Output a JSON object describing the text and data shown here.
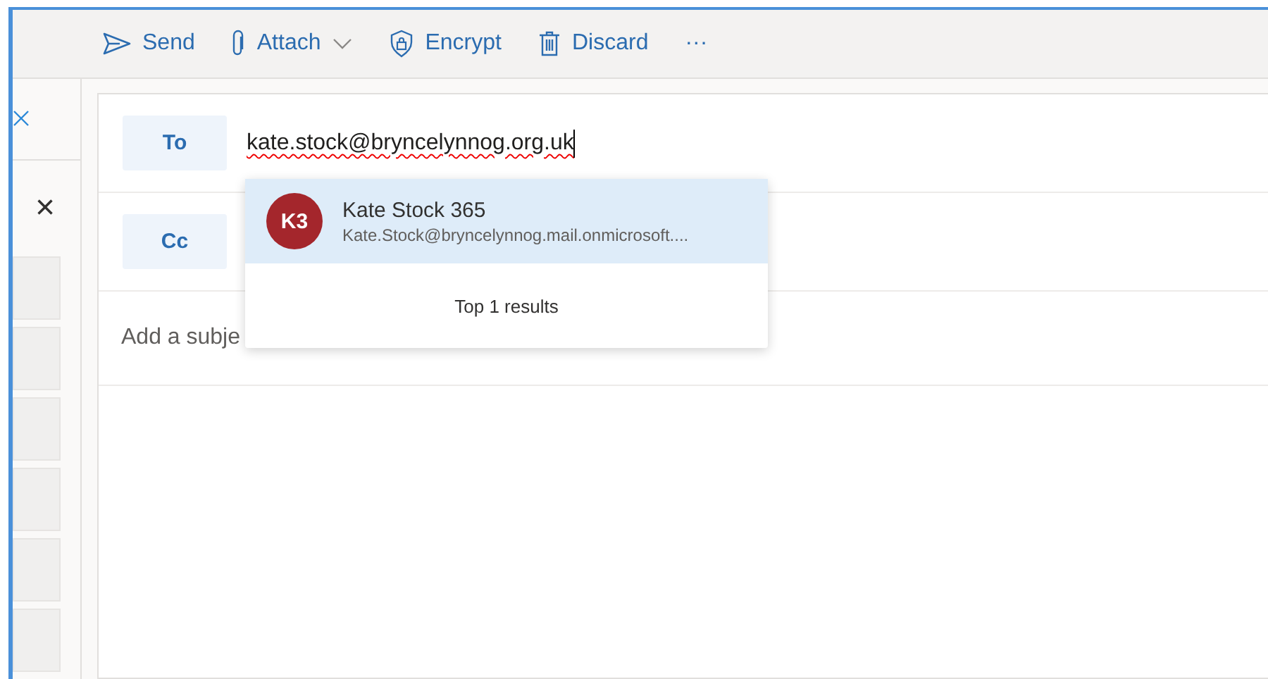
{
  "toolbar": [
    {
      "kind": "send",
      "label": "Send"
    },
    {
      "kind": "attach",
      "label": "Attach"
    },
    {
      "kind": "encrypt",
      "label": "Encrypt"
    },
    {
      "kind": "discard",
      "label": "Discard"
    },
    {
      "kind": "more",
      "label": "···"
    }
  ],
  "side_close": "×",
  "to": {
    "label": "To",
    "value": "kate.stock@bryncelynnog.org.uk"
  },
  "cc": {
    "label": "Cc"
  },
  "subject": {
    "placeholder": "Add a subje"
  },
  "suggestions": {
    "items": [
      {
        "initials": "K3",
        "name": "Kate Stock 365",
        "email": "Kate.Stock@bryncelynnog.mail.onmicrosoft....",
        "selected": true,
        "color": "#a4262c"
      }
    ],
    "footer": "Top 1 results"
  }
}
